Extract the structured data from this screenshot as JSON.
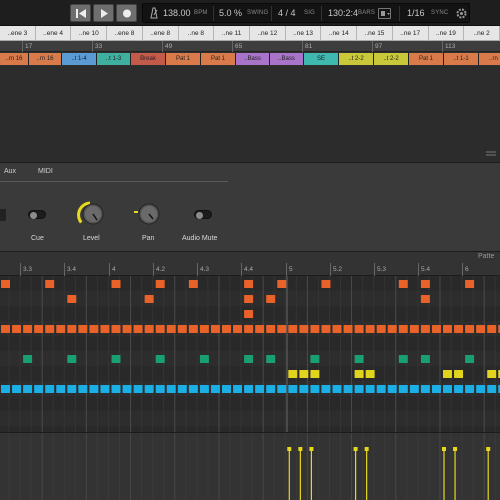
{
  "transport": {
    "tempo": "138.00",
    "tempo_unit": "BPM",
    "swing": "5.0 %",
    "swing_label": "SWING",
    "signature": "4 / 4",
    "signature_label": "SIG",
    "position": "130:2:4",
    "position_label": "BARS",
    "quantize": "1/16",
    "sync_label": "SYNC"
  },
  "scenes": [
    "..ene 3",
    "..ene 4",
    "..ne 10",
    "..ene 8",
    "..ene 8",
    "..ne 8",
    "..ne 11",
    "..ne 12",
    "..ne 13",
    "..ne 14",
    "..ne 15",
    "..ne 17",
    "..ne 19",
    "..ne 2"
  ],
  "bar_numbers": [
    "17",
    "33",
    "49",
    "65",
    "81",
    "97",
    "113"
  ],
  "clips": [
    {
      "label": "..rn 16",
      "color": "#d97a4a"
    },
    {
      "label": "..rn 16",
      "color": "#d97a4a"
    },
    {
      "label": "..t 1-4",
      "color": "#5b9bd5"
    },
    {
      "label": "..t 1-3",
      "color": "#3fb0a0"
    },
    {
      "label": "Break",
      "color": "#c45a4a"
    },
    {
      "label": "Pat 1",
      "color": "#d97a4a"
    },
    {
      "label": "Pat 1",
      "color": "#d97a4a"
    },
    {
      "label": "..Bass",
      "color": "#a873c8"
    },
    {
      "label": "..Bass",
      "color": "#a873c8"
    },
    {
      "label": "SE",
      "color": "#3fb8b0"
    },
    {
      "label": "..t 2-2",
      "color": "#c8c83a"
    },
    {
      "label": "..t 2-2",
      "color": "#c8c83a"
    },
    {
      "label": "Pat 1",
      "color": "#d97a4a"
    },
    {
      "label": "..t 1-1",
      "color": "#d97a4a"
    },
    {
      "label": "..rn",
      "color": "#d97a4a"
    }
  ],
  "mixer": {
    "tabs": [
      "Aux",
      "MIDI"
    ],
    "cue_label": "Cue",
    "level_label": "Level",
    "pan_label": "Pan",
    "audio_mute_label": "Audio Mute"
  },
  "pattern": {
    "title": "Patte",
    "ruler": [
      "3.3",
      "3.4",
      "4",
      "4.2",
      "4.3",
      "4.4",
      "5",
      "5.2",
      "5.3",
      "5.4",
      "6"
    ]
  },
  "colors": {
    "orange": "#e8622a",
    "green": "#1aa070",
    "yellow": "#e2d41c",
    "cyan": "#1ab0e6",
    "velocity": "#e8d81c"
  },
  "icons": {
    "rewind": "rewind-icon",
    "play": "play-icon",
    "record": "record-icon",
    "metronome": "metronome-icon",
    "settings": "gear-icon"
  }
}
